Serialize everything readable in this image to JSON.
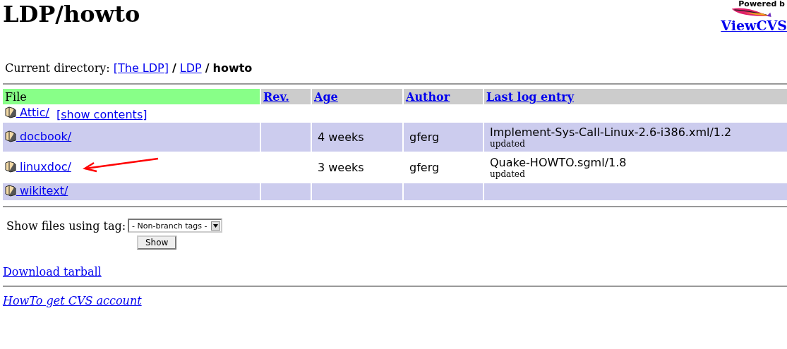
{
  "title": "LDP/howto",
  "logo": {
    "text": "Powered b"
  },
  "viewcvs_link": "ViewCVS",
  "breadcrumb": {
    "label": "Current directory:",
    "links": [
      "[The LDP]",
      "LDP"
    ],
    "separator": "/",
    "current": "howto"
  },
  "table": {
    "columns": [
      {
        "label": "File",
        "sorted": true
      },
      {
        "label": "Rev.",
        "sorted": false
      },
      {
        "label": "Age",
        "sorted": false
      },
      {
        "label": "Author",
        "sorted": false
      },
      {
        "label": "Last log entry",
        "sorted": false
      }
    ],
    "rows": [
      {
        "kind": "attic",
        "name": "Attic/",
        "action": "[show contents]"
      },
      {
        "kind": "dir",
        "name": "docbook/",
        "age": "4 weeks",
        "author": "gferg",
        "log": "Implement-Sys-Call-Linux-2.6-i386.xml/1.2",
        "note": "updated"
      },
      {
        "kind": "dir",
        "name": "linuxdoc/",
        "age": "3 weeks",
        "author": "gferg",
        "log": "Quake-HOWTO.sgml/1.8",
        "note": "updated",
        "annotated": true
      },
      {
        "kind": "dir",
        "name": "wikitext/"
      }
    ]
  },
  "tag_form": {
    "label": "Show files using tag:",
    "select_value": "- Non-branch tags -",
    "button": "Show"
  },
  "download_link": "Download tarball",
  "footer_link": "HowTo get CVS account"
}
